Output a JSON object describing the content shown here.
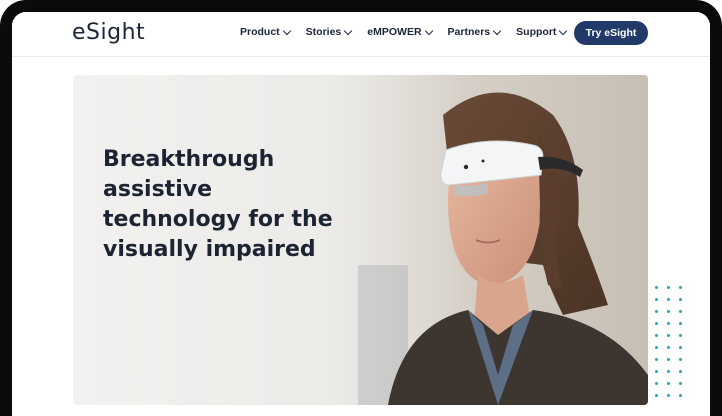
{
  "header": {
    "logo_text": "eSight",
    "nav": [
      {
        "label": "Product"
      },
      {
        "label": "Stories"
      },
      {
        "label": "eMPOWER"
      },
      {
        "label": "Partners"
      },
      {
        "label": "Support"
      }
    ],
    "cta_label": "Try eSight"
  },
  "hero": {
    "title": "Breakthrough assistive technology for the visually impaired",
    "photo_subject": "woman-wearing-esight-headset"
  },
  "colors": {
    "brand_navy": "#223a69",
    "text_dark": "#1c2333",
    "accent_teal": "#2aa7ad"
  }
}
